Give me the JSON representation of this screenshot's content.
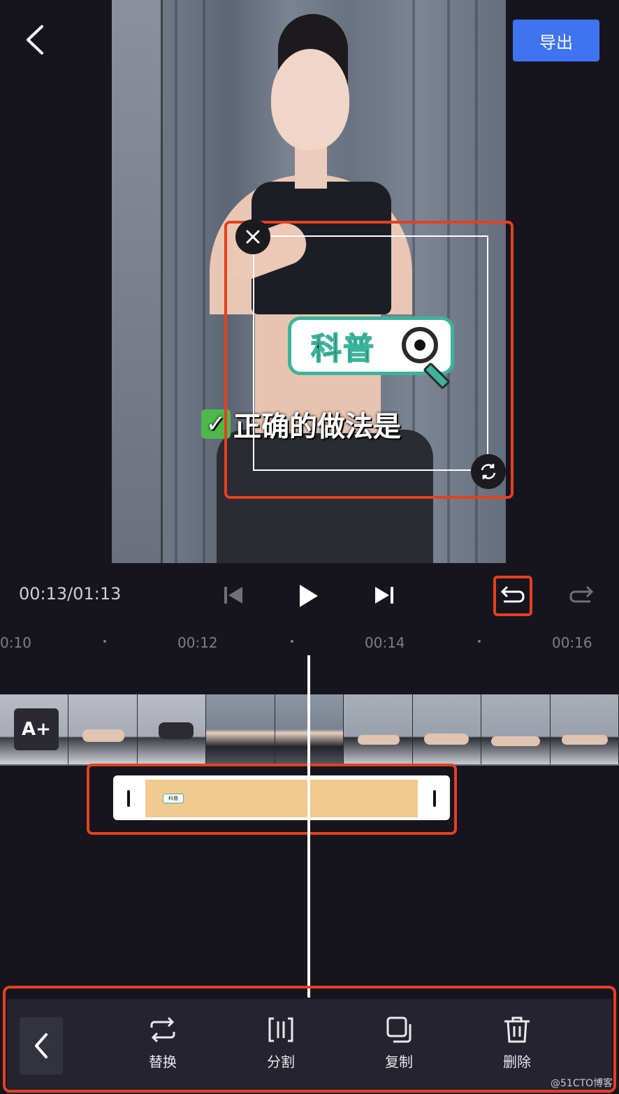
{
  "header": {
    "export_label": "导出"
  },
  "preview": {
    "sticker_text": "科普",
    "subtitle_text": "正确的做法是",
    "subtitle_check": "✓"
  },
  "playback": {
    "time": "00:13/01:13"
  },
  "ruler": {
    "ticks": [
      "0:10",
      "00:12",
      "00:14",
      "00:16"
    ]
  },
  "timeline": {
    "add_text_label": "A+",
    "sticker_clip_label": "科普"
  },
  "toolbar": {
    "items": [
      {
        "label": "替换",
        "icon": "replace-icon"
      },
      {
        "label": "分割",
        "icon": "split-icon"
      },
      {
        "label": "复制",
        "icon": "copy-icon"
      },
      {
        "label": "删除",
        "icon": "trash-icon"
      }
    ]
  },
  "watermark": "@51CTO博客",
  "colors": {
    "accent_blue": "#3f74f0",
    "highlight_red": "#e5401f",
    "sticker_green": "#3bb49b",
    "clip_orange": "#f2c98e",
    "background": "#16151e"
  }
}
